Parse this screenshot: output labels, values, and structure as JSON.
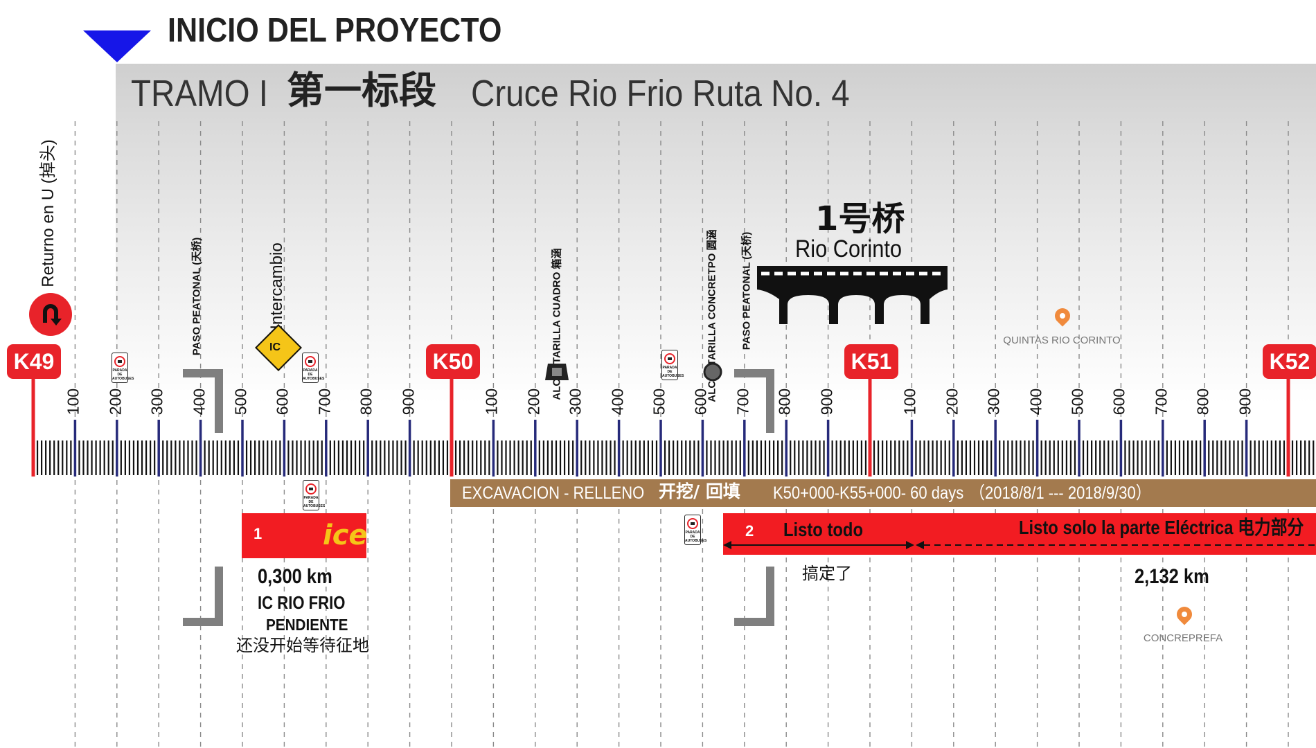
{
  "header": {
    "title": "INICIO DEL PROYECTO",
    "tramo_label": "TRAMO I",
    "tramo_cn": "第一标段",
    "tramo_name": "Cruce Rio Frio Ruta No. 4"
  },
  "kilometers": [
    "K49",
    "K50",
    "K51",
    "K52"
  ],
  "distance_ticks": [
    "100",
    "200",
    "300",
    "400",
    "500",
    "600",
    "700",
    "800",
    "900"
  ],
  "features": {
    "u_turn": "Returno en U (掉头)",
    "paso_peatonal_1": "PASO PEATONAL (天桥)",
    "intercambio": "Intercambio",
    "ic_sign": "IC",
    "alcantarilla_cuadro": "ALCANTARILLA CUADRO 箱涵",
    "alcantarilla_concreto": "ALCANTARILLA CONCRETPO 圆涵",
    "paso_peatonal_2": "PASO PEATONAL (天桥)",
    "bridge_cn": "1号桥",
    "bridge_name": "Rio Corinto",
    "bus_stop": "PARADA DE AUTOBUSES",
    "loc_quintas": "QUINTAS RIO CORINTO",
    "loc_concreprefa": "CONCREPREFA"
  },
  "work_bar": {
    "activity_es": "EXCAVACION - RELLENO",
    "activity_cn": "开挖/ 回填",
    "range": "K50+000-K55+000- 60 days",
    "dates": "（2018/8/1 --- 2018/9/30）"
  },
  "segment_1": {
    "number": "1",
    "logo": "ice",
    "length": "0,300 km",
    "name": "IC RIO FRIO",
    "status": "PENDIENTE",
    "status_cn": "还没开始等待征地"
  },
  "segment_2": {
    "number": "2",
    "status_done": "Listo todo",
    "status_done_cn": "搞定了",
    "status_partial": "Listo solo la parte Eléctrica 电力部分",
    "length": "2,132 km"
  },
  "colors": {
    "red": "#e8232a",
    "brown": "#a37a4e",
    "navy": "#262a7a",
    "marker_blue": "#1616e8",
    "ic_sign_yellow": "#f5c518",
    "pin_orange": "#f08a3c"
  }
}
